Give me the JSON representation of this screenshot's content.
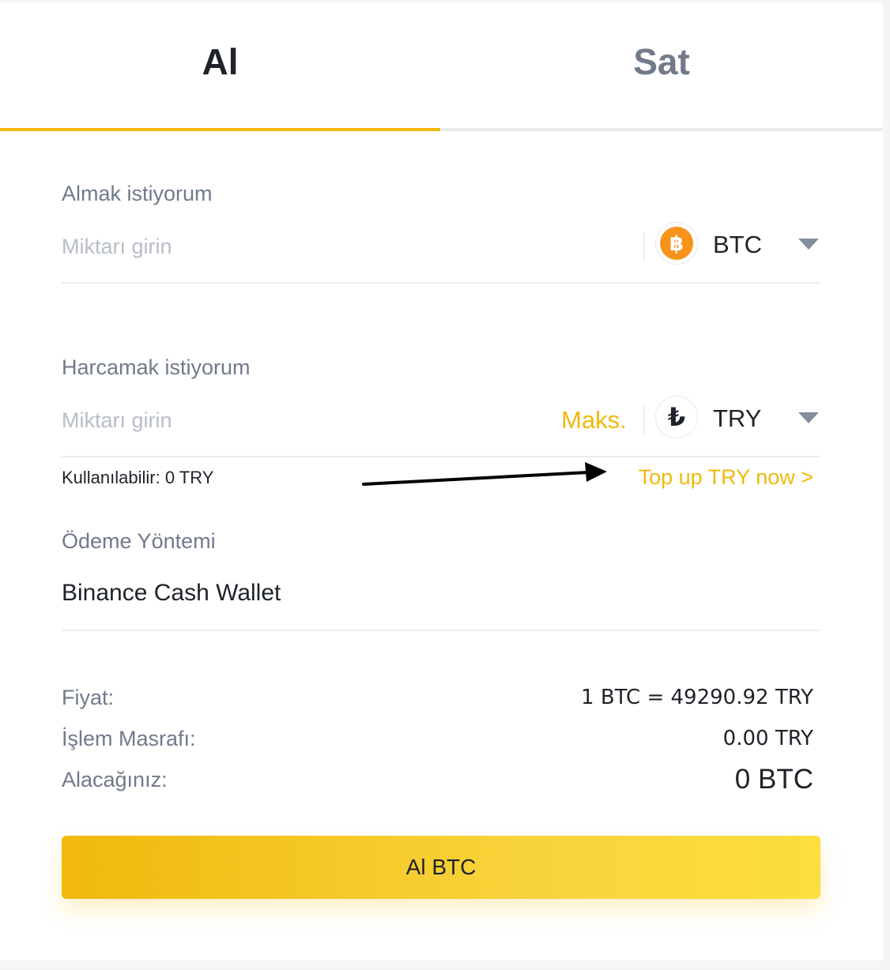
{
  "tabs": {
    "buy": "Al",
    "sell": "Sat"
  },
  "receive": {
    "label": "Almak istiyorum",
    "placeholder": "Miktarı girin",
    "currency": "BTC",
    "currency_icon": "bitcoin-icon"
  },
  "spend": {
    "label": "Harcamak istiyorum",
    "placeholder": "Miktarı girin",
    "max_label": "Maks.",
    "currency": "TRY",
    "currency_icon": "turkish-lira-icon"
  },
  "available": {
    "text": "Kullanılabilir: 0 TRY",
    "topup": "Top up TRY now >"
  },
  "payment": {
    "label": "Ödeme Yöntemi",
    "method": "Binance Cash Wallet"
  },
  "summary": {
    "price_label": "Fiyat:",
    "price_value": "1 BTC = 49290.92 TRY",
    "fee_label": "İşlem Masrafı:",
    "fee_value": "0.00 TRY",
    "receive_label": "Alacağınız:",
    "receive_value": "0 BTC"
  },
  "button": {
    "label": "Al BTC"
  },
  "colors": {
    "accent": "#f0b90b",
    "text": "#1e2329",
    "muted": "#707a8a",
    "btc": "#f7931a"
  }
}
